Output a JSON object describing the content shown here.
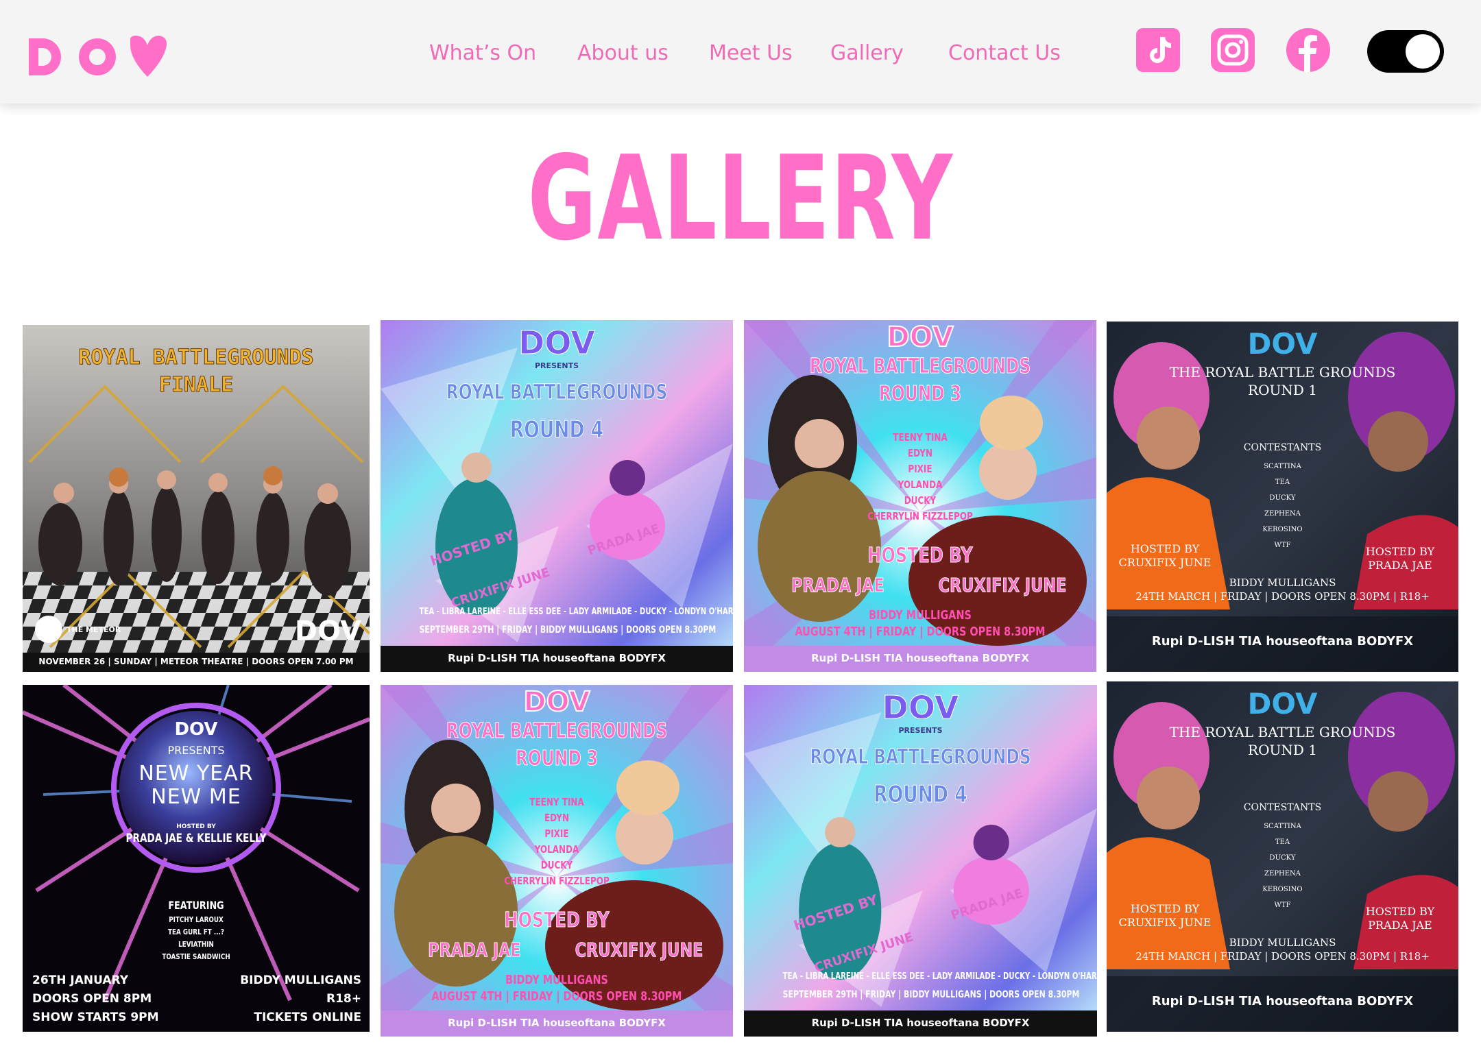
{
  "brand": {
    "logo_text": "DOV",
    "accent_color": "#ff6ec7"
  },
  "nav": {
    "links": [
      "What’s On",
      "About us",
      "Meet Us",
      "Gallery",
      "Contact Us"
    ]
  },
  "social": {
    "icons": [
      "tiktok-icon",
      "instagram-icon",
      "facebook-icon"
    ]
  },
  "theme_toggle": {
    "state": "dark-on"
  },
  "page": {
    "title": "GALLERY"
  },
  "gallery": {
    "finale": {
      "line1": "ROYAL BATTLEGROUNDS",
      "line2": "FINALE",
      "venue_logo": "THE METEOR",
      "footer": "NOVEMBER 26 | SUNDAY | METEOR THEATRE | DOORS OPEN 7.00 PM"
    },
    "round4": {
      "presents": "PRESENTS",
      "line1": "ROYAL BATTLEGROUNDS",
      "line2": "ROUND 4",
      "hosted": "HOSTED BY",
      "host1": "CRUXIFIX JUNE",
      "host2": "PRADA JAE",
      "contestants": "TEA - LIBRA LAREINE - ELLE ESS DEE - LADY ARMILADE - DUCKY - LONDYN O'HARA",
      "date": "SEPTEMBER 29TH | FRIDAY | BIDDY MULLIGANS | DOORS OPEN 8.30PM",
      "sponsors": "Rupi  D-LISH  TIA  houseoftana  BODYFX"
    },
    "round3": {
      "line1": "ROYAL BATTLEGROUNDS",
      "line2": "ROUND 3",
      "contestants": [
        "TEENY TINA",
        "EDYN",
        "PIXIE",
        "YOLANDA",
        "DUCKY",
        "CHERRYLIN FIZZLEPOP"
      ],
      "hosted": "HOSTED BY",
      "host1": "PRADA JAE",
      "host2": "CRUXIFIX JUNE",
      "venue": "BIDDY MULLIGANS",
      "date": "AUGUST 4TH | FRIDAY | DOORS OPEN 8.30PM",
      "sponsors": "Rupi  D-LISH  TIA  houseoftana  BODYFX"
    },
    "round1": {
      "line1": "THE ROYAL BATTLE GROUNDS",
      "line2": "ROUND 1",
      "contestants_label": "CONTESTANTS",
      "contestants": [
        "SCATTINA",
        "TEA",
        "DUCKY",
        "ZEPHENA",
        "KEROSINO",
        "WTF"
      ],
      "host_left": [
        "HOSTED BY",
        "CRUXIFIX JUNE"
      ],
      "host_right": [
        "HOSTED BY",
        "PRADA JAE"
      ],
      "venue": "BIDDY MULLIGANS",
      "date": "24TH MARCH | FRIDAY | DOORS OPEN 8.30PM | R18+",
      "sponsors": "Rupi  D-LISH  TIA  houseoftana  BODYFX"
    },
    "newyear": {
      "presents": "PRESENTS",
      "line1": "NEW YEAR",
      "line2": "NEW ME",
      "hosted": "HOSTED BY",
      "hosts": "PRADA JAE & KELLIE KELLY",
      "featuring": "FEATURING",
      "acts": [
        "PITCHY LAROUX",
        "TEA GURL FT ...?",
        "LEVIATHIN",
        "TOASTIE SANDWICH"
      ],
      "left": [
        "26TH JANUARY",
        "DOORS OPEN 8PM",
        "SHOW STARTS 9PM"
      ],
      "right": [
        "BIDDY MULLIGANS",
        "R18+",
        "TICKETS ONLINE"
      ]
    }
  }
}
